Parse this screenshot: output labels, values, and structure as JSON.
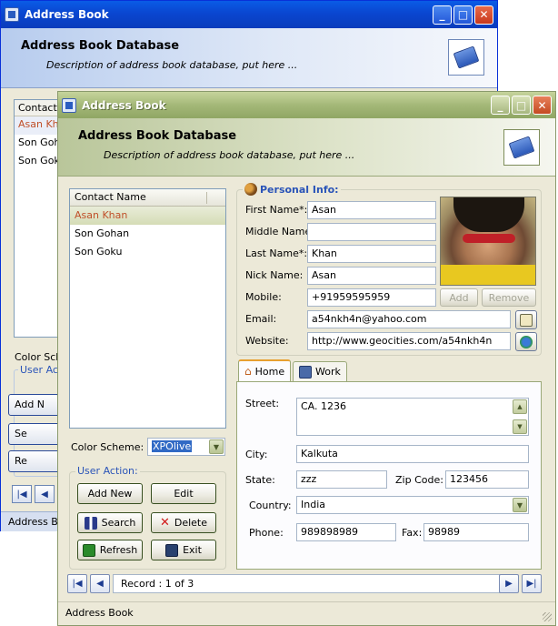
{
  "colors": {
    "blue_title": "#0a46d0",
    "olive_title": "#a4b878",
    "accent_orange": "#c0502a",
    "group_label": "#2a54b8"
  },
  "back_window": {
    "title": "Address Book",
    "header_title": "Address Book Database",
    "header_desc": "Description of address book database, put here ...",
    "list_header": "Contact N",
    "items": [
      "Asan Kha",
      "Son Goh",
      "Son Gok"
    ],
    "color_scheme_label": "Color Sche",
    "user_action_label": "User Act",
    "buttons": [
      "Add N",
      "Se",
      "Re"
    ],
    "status": "Address Bo"
  },
  "window": {
    "title": "Address Book",
    "header_title": "Address Book Database",
    "header_desc": "Description of address book database, put here ...",
    "contact_list": {
      "header": "Contact Name",
      "items": [
        "Asan Khan",
        "Son Gohan",
        "Son Goku"
      ]
    },
    "color_scheme": {
      "label": "Color Scheme:",
      "value": "XPOlive"
    },
    "user_action": {
      "label": "User Action:",
      "add": "Add New",
      "edit": "Edit",
      "search": "Search",
      "delete": "Delete",
      "refresh": "Refresh",
      "exit": "Exit"
    },
    "personal": {
      "label": "Personal Info:",
      "first_name_label": "First Name*:",
      "first_name": "Asan",
      "middle_name_label": "Middle Name:",
      "middle_name": "",
      "last_name_label": "Last Name*:",
      "last_name": "Khan",
      "nick_name_label": "Nick Name:",
      "nick_name": "Asan",
      "mobile_label": "Mobile:",
      "mobile": "+91959595959",
      "email_label": "Email:",
      "email": "a54nkh4n@yahoo.com",
      "website_label": "Website:",
      "website": "http://www.geocities.com/a54nkh4n",
      "add_btn": "Add",
      "remove_btn": "Remove"
    },
    "tabs": [
      "Home",
      "Work"
    ],
    "address": {
      "street_label": "Street:",
      "street": "CA. 1236",
      "city_label": "City:",
      "city": "Kalkuta",
      "state_label": "State:",
      "state": "zzz",
      "zip_label": "Zip Code:",
      "zip": "123456",
      "country_label": "Country:",
      "country": "India",
      "phone_label": "Phone:",
      "phone": "989898989",
      "fax_label": "Fax:",
      "fax": "98989"
    },
    "record": "Record : 1 of 3",
    "status": "Address Book"
  },
  "icons": [
    "app-icon",
    "minimize-icon",
    "maximize-icon",
    "close-icon",
    "book-icon",
    "users-icon",
    "home-icon",
    "work-icon",
    "email-icon",
    "web-icon",
    "binoculars-icon",
    "delete-x-icon",
    "refresh-icon",
    "exit-icon",
    "first-icon",
    "prev-icon",
    "next-icon",
    "last-icon"
  ]
}
